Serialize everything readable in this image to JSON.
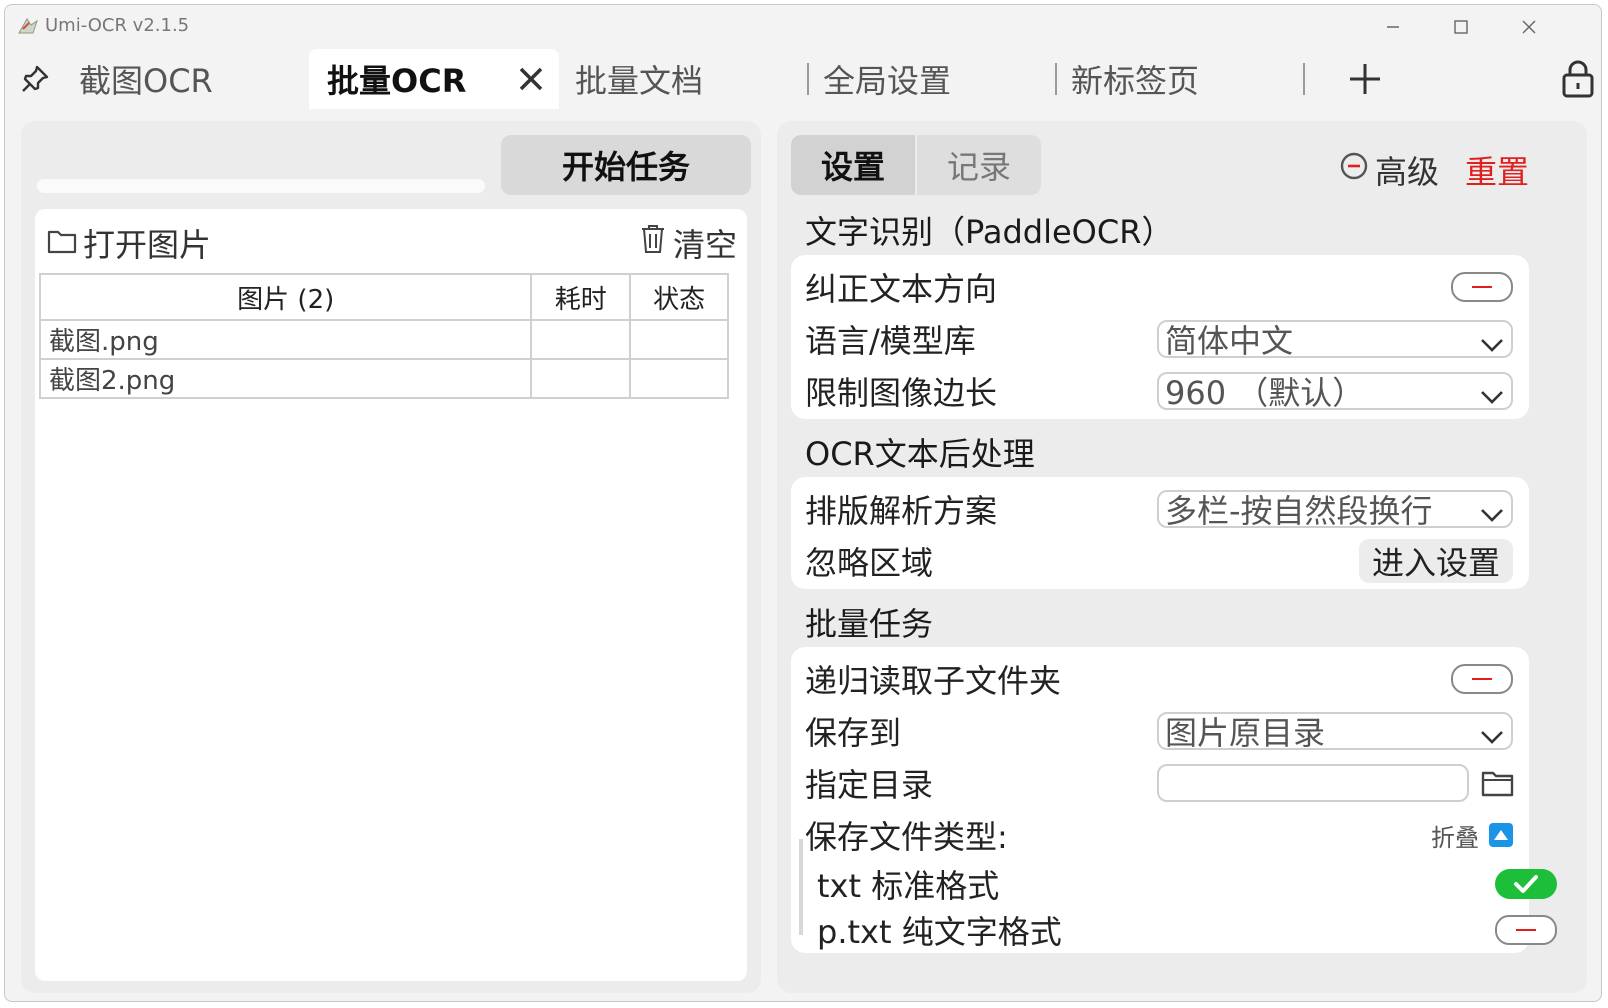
{
  "window": {
    "title": "Umi-OCR v2.1.5",
    "controls": [
      "minimize",
      "maximize",
      "close"
    ]
  },
  "tabs": [
    {
      "label": "截图OCR",
      "active": false
    },
    {
      "label": "批量OCR",
      "active": true
    },
    {
      "label": "批量文档",
      "active": false
    },
    {
      "label": "全局设置",
      "active": false
    },
    {
      "label": "新标签页",
      "active": false
    }
  ],
  "left": {
    "start_button": "开始任务",
    "open_images": "打开图片",
    "clear": "清空",
    "table": {
      "headers": [
        "图片 (2)",
        "耗时",
        "状态"
      ],
      "rows": [
        [
          "截图.png",
          "",
          ""
        ],
        [
          "截图2.png",
          "",
          ""
        ]
      ]
    }
  },
  "right": {
    "tabs": [
      "设置",
      "记录"
    ],
    "advanced": "高级",
    "reset": "重置",
    "sections": {
      "ocr": {
        "title": "文字识别（PaddleOCR）",
        "correct_direction": "纠正文本方向",
        "language_label": "语言/模型库",
        "language_value": "简体中文",
        "limit_label": "限制图像边长",
        "limit_value": "960 （默认）"
      },
      "post": {
        "title": "OCR文本后处理",
        "layout_label": "排版解析方案",
        "layout_value": "多栏-按自然段换行",
        "ignore_label": "忽略区域",
        "ignore_button": "进入设置"
      },
      "batch": {
        "title": "批量任务",
        "recursive": "递归读取子文件夹",
        "save_to_label": "保存到",
        "save_to_value": "图片原目录",
        "dir_label": "指定目录",
        "dir_value": "",
        "file_types_label": "保存文件类型:",
        "fold_label": "折叠",
        "types": [
          {
            "label": "txt 标准格式",
            "enabled": true
          },
          {
            "label": "p.txt 纯文字格式",
            "enabled": false
          }
        ]
      }
    }
  },
  "colors": {
    "accent_red": "#e0201f",
    "toggle_on": "#1dbf3a",
    "fold_blue": "#1a94e6"
  }
}
